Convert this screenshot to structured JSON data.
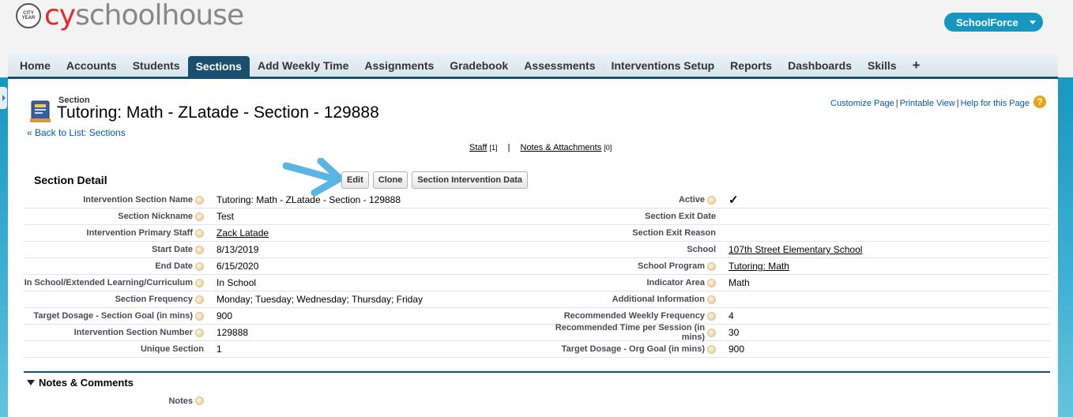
{
  "brand": {
    "seal_text": "CITY YEAR",
    "name_red": "cy",
    "name_gray": "schoolhouse",
    "app_switcher": "SchoolForce"
  },
  "tabs": [
    "Home",
    "Accounts",
    "Students",
    "Sections",
    "Add Weekly Time",
    "Assignments",
    "Gradebook",
    "Assessments",
    "Interventions Setup",
    "Reports",
    "Dashboards",
    "Skills",
    "+"
  ],
  "active_tab": "Sections",
  "header": {
    "type_label": "Section",
    "title": "Tutoring: Math - ZLatade - Section - 129888",
    "back_link": "« Back to List: Sections",
    "customize": "Customize Page",
    "printable": "Printable View",
    "help": "Help for this Page",
    "help_icon": "?"
  },
  "related": {
    "staff": "Staff",
    "staff_count": "[1]",
    "notes": "Notes & Attachments",
    "notes_count": "[0]",
    "separator": "|"
  },
  "detail": {
    "title": "Section Detail",
    "edit": "Edit",
    "clone": "Clone",
    "intervention_data": "Section Intervention Data"
  },
  "fields": [
    {
      "l": "Intervention Section Name",
      "v": "Tutoring: Math - ZLatade - Section - 129888",
      "l2": "Active",
      "v2": "✓"
    },
    {
      "l": "Section Nickname",
      "v": "Test",
      "l2": "Section Exit Date",
      "v2": ""
    },
    {
      "l": "Intervention Primary Staff",
      "v": "Zack Latade",
      "l2": "Section Exit Reason",
      "v2": ""
    },
    {
      "l": "Start Date",
      "v": "8/13/2019",
      "l2": "School",
      "v2": "107th Street Elementary School"
    },
    {
      "l": "End Date",
      "v": "6/15/2020",
      "l2": "School Program",
      "v2": "Tutoring: Math"
    },
    {
      "l": "In School/Extended Learning/Curriculum",
      "v": "In School",
      "l2": "Indicator Area",
      "v2": "Math"
    },
    {
      "l": "Section Frequency",
      "v": "Monday; Tuesday; Wednesday; Thursday; Friday",
      "l2": "Additional Information",
      "v2": ""
    },
    {
      "l": "Target Dosage - Section Goal (in mins)",
      "v": "900",
      "l2": "Recommended Weekly Frequency",
      "v2": "4"
    },
    {
      "l": "Intervention Section Number",
      "v": "129888",
      "l2": "Recommended Time per Session (in mins)",
      "v2": "30"
    },
    {
      "l": "Unique Section",
      "v": "1",
      "l2": "Target Dosage - Org Goal (in mins)",
      "v2": "900"
    }
  ],
  "notes": {
    "section_title": "Notes & Comments",
    "notes_label": "Notes"
  }
}
